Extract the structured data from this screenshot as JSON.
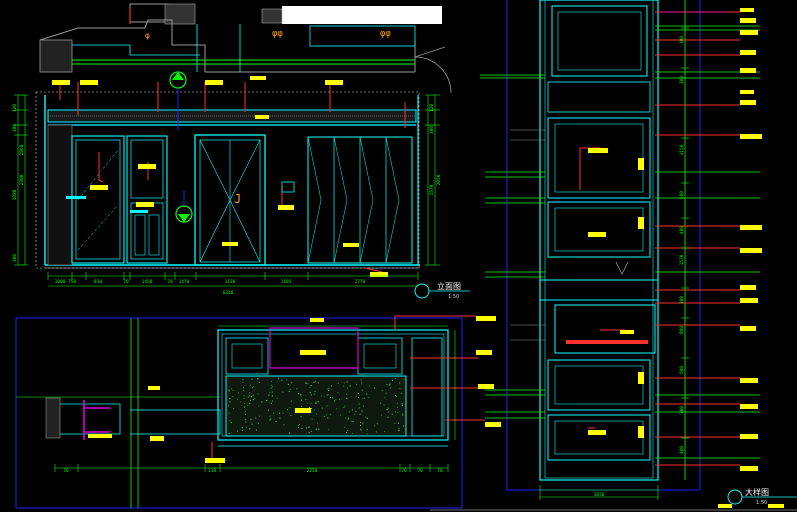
{
  "drawing": {
    "titles": {
      "elevation_main": "立面图",
      "elevation_main_sub": "1:50",
      "elevation_big": "大样图",
      "elevation_big_sub": "1:50"
    },
    "dims_bottom_left": [
      "1000",
      "750",
      "830",
      "70",
      "1450",
      "70",
      "1470",
      "1130",
      "1185",
      "2770"
    ],
    "dim_total_left": "6240",
    "dims_left_vertical": [
      "120",
      "380",
      "1080",
      "2300",
      "2860",
      "300"
    ],
    "dims_right_vertical": [
      "2050",
      "1570",
      "380",
      "120"
    ],
    "dims_bottom_center": [
      "70",
      "110",
      "2250",
      "70",
      "70",
      "70"
    ],
    "dims_big_bottom": "1870",
    "dims_big_right": [
      "100",
      "300",
      "1150",
      "500",
      "400",
      "1570",
      "300",
      "800",
      "500",
      "300",
      "400"
    ],
    "colors": {
      "cyan": "#00ffff",
      "green": "#00ff00",
      "yellow": "#ffff00",
      "red": "#ff3030",
      "magenta": "#ff00ff",
      "blue": "#2020ff",
      "white": "#ffffff",
      "orange": "#ff9900",
      "gray": "#9a9a9a"
    }
  }
}
